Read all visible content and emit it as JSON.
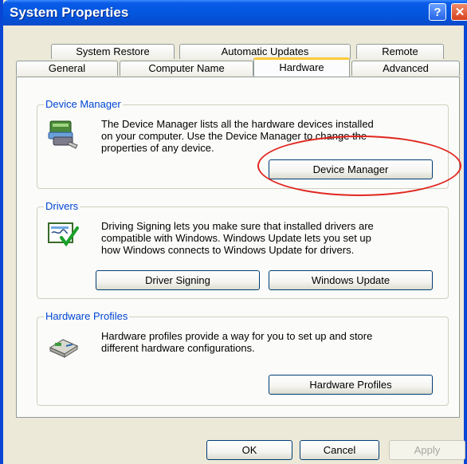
{
  "window": {
    "title": "System Properties",
    "help_glyph": "?",
    "close_glyph": "✕"
  },
  "tabs_back": [
    "System Restore",
    "Automatic Updates",
    "Remote"
  ],
  "tabs_front": [
    "General",
    "Computer Name",
    "Hardware",
    "Advanced"
  ],
  "active_tab": "Hardware",
  "device_manager": {
    "label": "Device Manager",
    "lines": [
      "The Device Manager lists all the hardware devices installed",
      "on your computer. Use the Device Manager to change the",
      "properties of any device."
    ],
    "button": "Device Manager"
  },
  "drivers": {
    "label": "Drivers",
    "lines": [
      "Driving Signing lets you make sure that installed drivers are",
      "compatible with Windows. Windows Update lets you set up",
      "how Windows connects to Windows Update for drivers."
    ],
    "signing_button": "Driver Signing",
    "update_button": "Windows Update"
  },
  "hardware_profiles": {
    "label": "Hardware Profiles",
    "lines": [
      "Hardware profiles provide a way for you to set up and store",
      "different hardware configurations."
    ],
    "button": "Hardware Profiles"
  },
  "footer": {
    "ok": "OK",
    "cancel": "Cancel",
    "apply": "Apply"
  },
  "colors": {
    "title_blue": "#0458e0",
    "group_label": "#0046d5",
    "annotation": "#e0261e",
    "active_tab_top": "#ffc83c"
  },
  "icons": [
    "help-icon",
    "close-icon",
    "device-manager-icon",
    "driver-signing-icon",
    "hardware-profiles-icon"
  ]
}
